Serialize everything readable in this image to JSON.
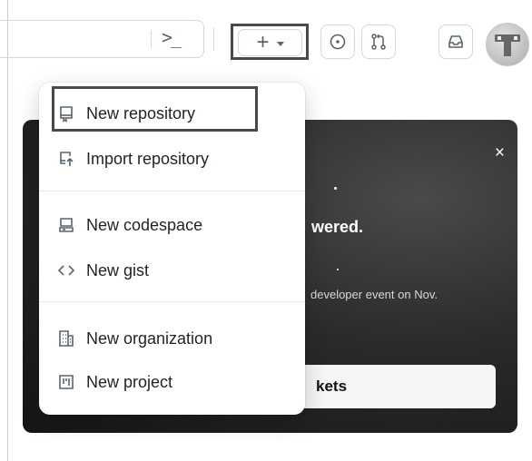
{
  "header": {
    "command_palette_icon": ">_",
    "create_button_icon": "plus-icon",
    "create_caret_icon": "triangle-down-icon",
    "issues_icon": "issue-opened-icon",
    "pull_requests_icon": "git-pull-request-icon",
    "inbox_icon": "inbox-icon",
    "avatar": "user-avatar"
  },
  "create_menu": {
    "items": [
      {
        "label": "New repository",
        "icon": "repo-icon"
      },
      {
        "label": "Import repository",
        "icon": "repo-push-icon"
      },
      {
        "label": "New codespace",
        "icon": "codespaces-icon"
      },
      {
        "label": "New gist",
        "icon": "code-icon"
      },
      {
        "label": "New organization",
        "icon": "organization-icon"
      },
      {
        "label": "New project",
        "icon": "project-icon"
      }
    ]
  },
  "banner": {
    "close_label": "×",
    "headline_fragment": "wered.",
    "subtext_fragment": "developer event on Nov.",
    "cta_fragment": "kets"
  },
  "colors": {
    "banner_bg": "#1c1c1c",
    "highlight_outline": "#4a4a4a",
    "icon_gray": "#59636e"
  }
}
